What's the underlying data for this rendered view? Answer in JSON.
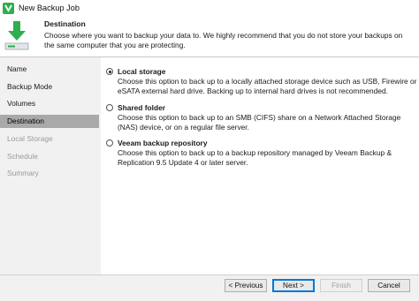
{
  "window": {
    "title": "New Backup Job"
  },
  "header": {
    "title": "Destination",
    "description": "Choose where you want to backup your data to. We highly recommend that you do not store your backups on the same computer that you are protecting."
  },
  "sidebar": {
    "items": [
      {
        "label": "Name",
        "state": "normal"
      },
      {
        "label": "Backup Mode",
        "state": "normal"
      },
      {
        "label": "Volumes",
        "state": "normal"
      },
      {
        "label": "Destination",
        "state": "active"
      },
      {
        "label": "Local Storage",
        "state": "disabled"
      },
      {
        "label": "Schedule",
        "state": "disabled"
      },
      {
        "label": "Summary",
        "state": "disabled"
      }
    ]
  },
  "options": [
    {
      "title": "Local storage",
      "checked": true,
      "description": "Choose this option to back up to a locally attached storage device such as USB, Firewire or eSATA external hard drive. Backing up to internal hard drives is not recommended."
    },
    {
      "title": "Shared folder",
      "checked": false,
      "description": "Choose this option to back up to an SMB (CIFS) share on a Network Attached Storage (NAS) device, or on a regular file server."
    },
    {
      "title": "Veeam backup repository",
      "checked": false,
      "description": "Choose this option to back up to a backup repository managed by Veeam Backup & Replication 9.5 Update 4 or later server."
    }
  ],
  "buttons": {
    "previous": "< Previous",
    "next": "Next >",
    "finish": "Finish",
    "cancel": "Cancel"
  },
  "colors": {
    "accent": "#2fae4f",
    "active_nav": "#a9a9a9",
    "focus_border": "#0078d7"
  }
}
